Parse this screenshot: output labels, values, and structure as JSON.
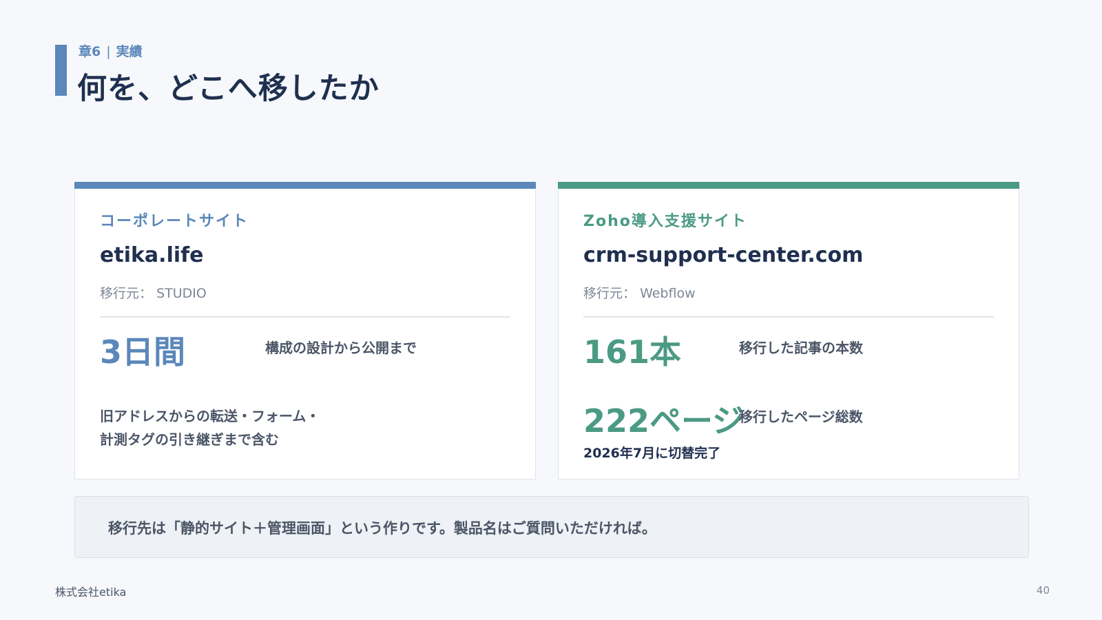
{
  "header": {
    "chapter": "章6",
    "separator": "|",
    "section": "実績",
    "title": "何を、どこへ移したか"
  },
  "cards": [
    {
      "label": "コーポレートサイト",
      "domain": "etika.life",
      "source_label": "移行元：",
      "source_value": "STUDIO",
      "metrics": [
        {
          "value": "3日間",
          "description": "構成の設計から公開まで"
        }
      ],
      "note_lines": [
        "旧アドレスからの転送・フォーム・",
        "計測タグの引き継ぎまで含む"
      ]
    },
    {
      "label": "Zoho導入支援サイト",
      "domain": "crm-support-center.com",
      "source_label": "移行元：",
      "source_value": "Webflow",
      "metrics": [
        {
          "value": "161本",
          "description": "移行した記事の本数"
        },
        {
          "value": "222ページ",
          "description": "移行したページ総数"
        }
      ],
      "sub_note": "2026年7月に切替完了"
    }
  ],
  "banner": {
    "text": "移行先は「静的サイト＋管理画面」という作りです。製品名はご質問いただければ。"
  },
  "footer": {
    "company": "株式会社etika",
    "page_number": "40"
  },
  "colors": {
    "accent_blue": "#5b87ba",
    "accent_green": "#4b9a84",
    "title_navy": "#1f3050"
  }
}
